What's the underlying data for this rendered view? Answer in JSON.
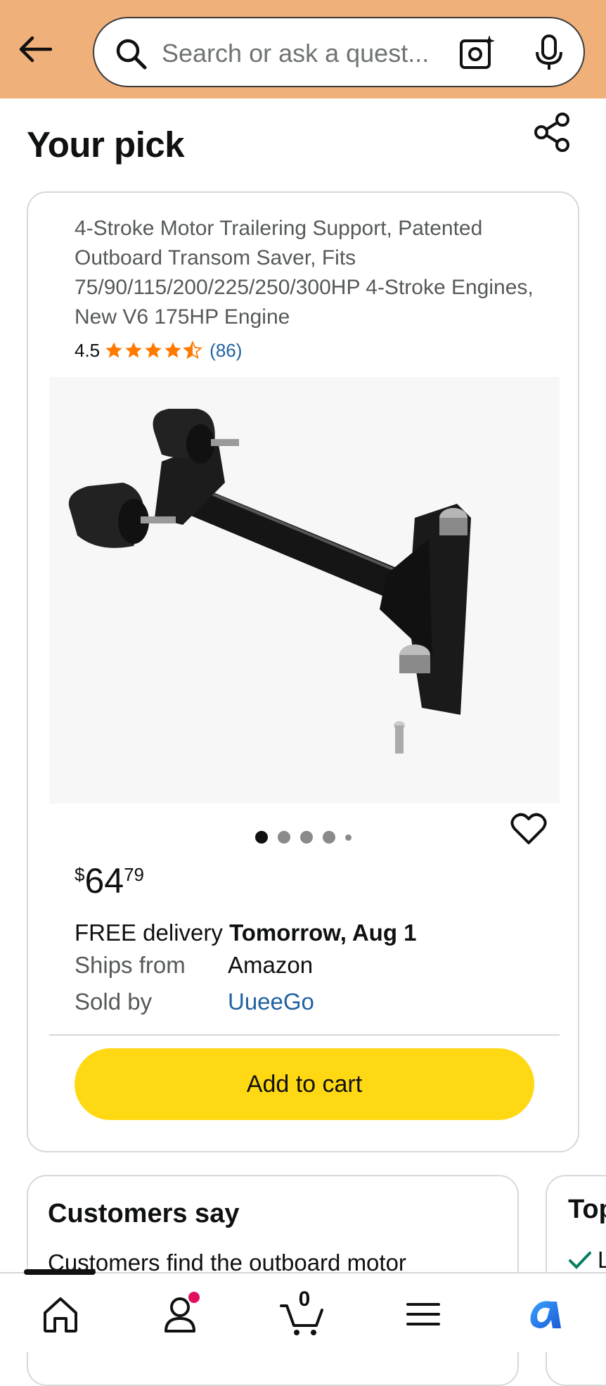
{
  "search": {
    "placeholder": "Search or ask a quest..."
  },
  "header": {
    "page_title": "Your pick"
  },
  "product": {
    "title": "4-Stroke Motor Trailering Support, Patented Outboard Transom Saver, Fits 75/90/115/200/225/250/300HP 4-Stroke Engines, New V6 175HP Engine",
    "rating": "4.5",
    "rating_stars": 4.5,
    "review_count": "(86)",
    "image_count": 5,
    "active_image": 1,
    "price": {
      "symbol": "$",
      "whole": "64",
      "fraction": "79"
    },
    "delivery_prefix": "FREE delivery",
    "delivery_date": "Tomorrow, Aug 1",
    "ships_from_label": "Ships from",
    "ships_from_value": "Amazon",
    "sold_by_label": "Sold by",
    "sold_by_value": "UueeGo",
    "add_to_cart_label": "Add to cart"
  },
  "customers_say": {
    "title": "Customers say",
    "text": "Customers find the outboard motor"
  },
  "top_card": {
    "title": "Top",
    "item": "L"
  },
  "bottom_nav": {
    "cart_count": "0",
    "items": [
      "home-icon",
      "account-icon",
      "cart-icon",
      "menu-icon",
      "rufus-icon"
    ]
  },
  "colors": {
    "header_bg": "#f0b07a",
    "add_to_cart": "#ffd814",
    "star": "#ff7a00",
    "link": "#2162a1",
    "notification_dot": "#e0105f"
  }
}
